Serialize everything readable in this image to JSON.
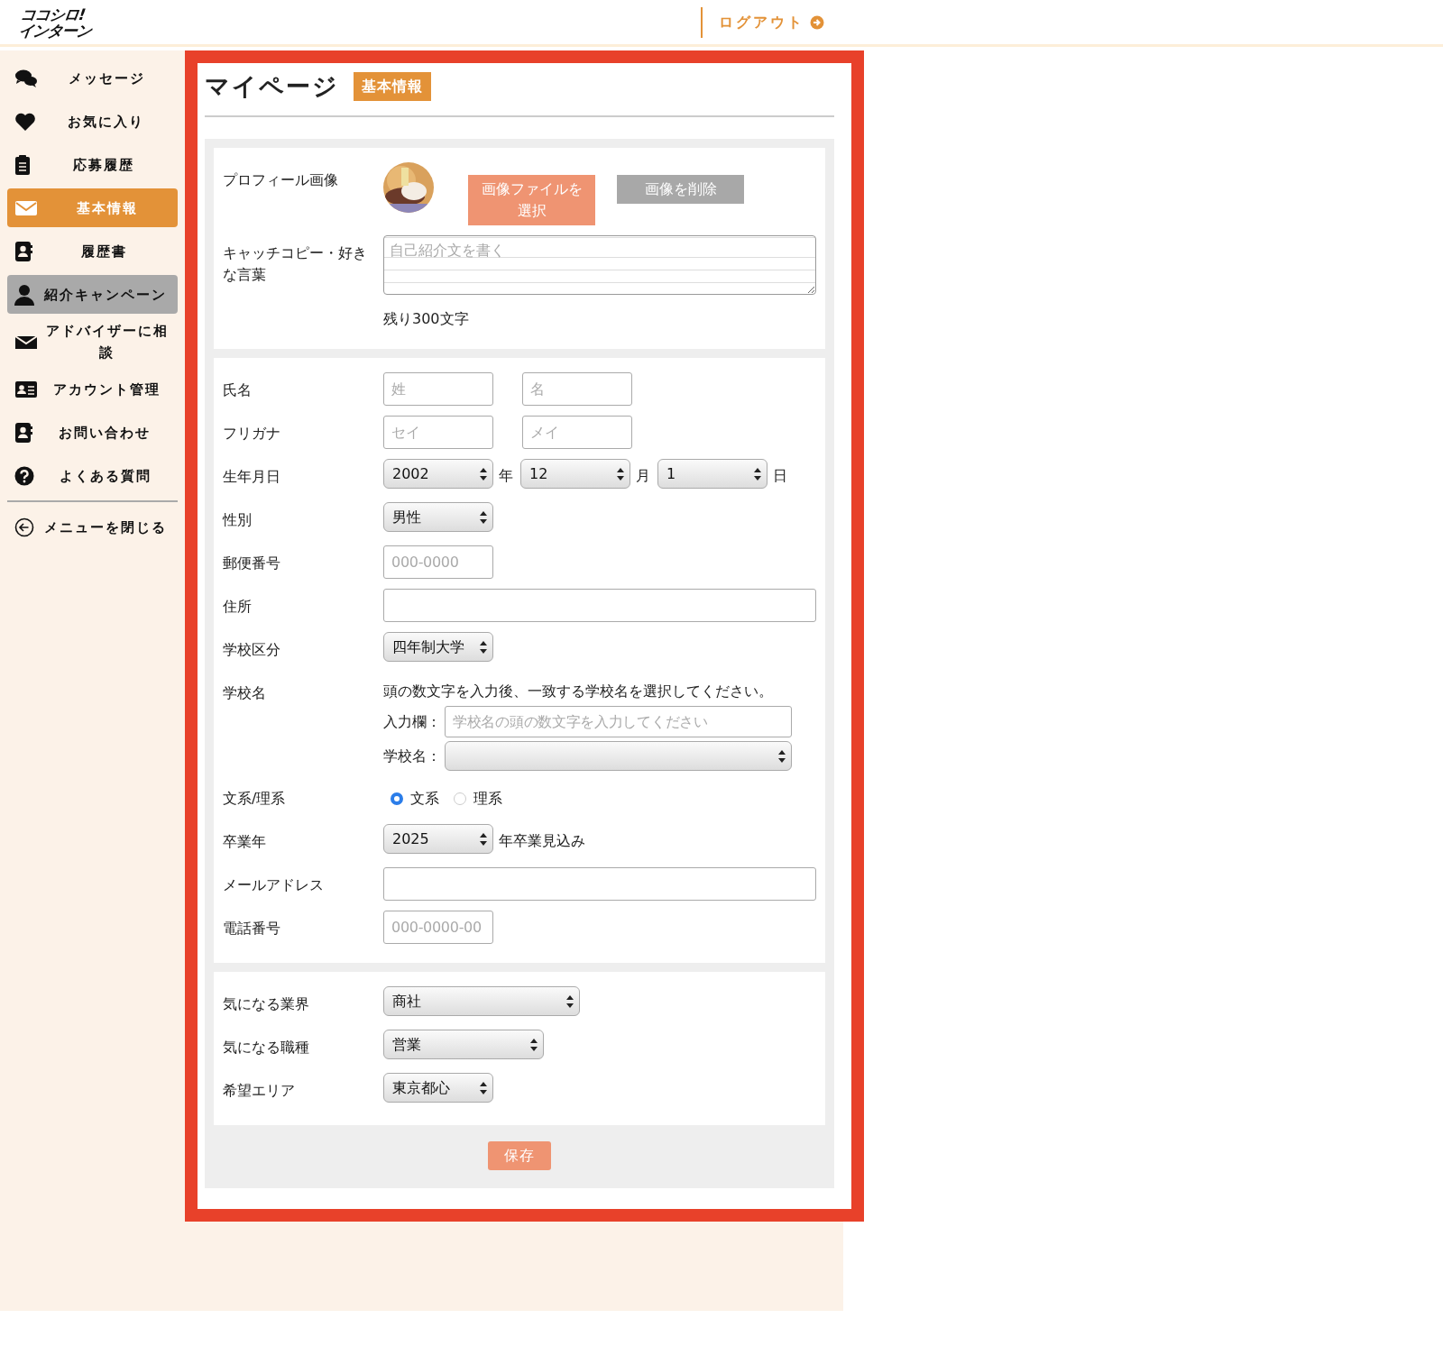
{
  "header": {
    "logo": [
      "ココシロ!",
      "インターン"
    ],
    "logout": "ログアウト"
  },
  "sidebar": {
    "items": [
      {
        "label": "メッセージ",
        "selected": false,
        "highlighted": false
      },
      {
        "label": "お気に入り",
        "selected": false,
        "highlighted": false
      },
      {
        "label": "応募履歴",
        "selected": false,
        "highlighted": false
      },
      {
        "label": "基本情報",
        "selected": true,
        "highlighted": false
      },
      {
        "label": "履歴書",
        "selected": false,
        "highlighted": false
      },
      {
        "label": "紹介キャンペーン",
        "selected": false,
        "highlighted": true
      },
      {
        "label": "アドバイザーに相談",
        "selected": false,
        "highlighted": false
      },
      {
        "label": "アカウント管理",
        "selected": false,
        "highlighted": false
      },
      {
        "label": "お問い合わせ",
        "selected": false,
        "highlighted": false
      },
      {
        "label": "よくある質問",
        "selected": false,
        "highlighted": false
      }
    ],
    "close": "メニューを閉じる"
  },
  "page": {
    "title": "マイページ",
    "badge": "基本情報"
  },
  "sections": [
    {
      "rows": [
        {
          "label": "プロフィール画像",
          "buttons": [
            {
              "label": "画像ファイルを選択"
            },
            {
              "label": "画像を削除"
            }
          ]
        },
        {
          "kind": "textarea",
          "label": "キャッチコピー・好きな言葉",
          "placeholder": "自己紹介文を書く",
          "note": "残り300文字"
        }
      ]
    },
    {
      "rows": [
        {
          "kind": "pair",
          "label": "氏名",
          "fields": [
            {
              "placeholder": "姓"
            },
            {
              "placeholder": "名"
            }
          ]
        },
        {
          "kind": "pair",
          "label": "フリガナ",
          "fields": [
            {
              "placeholder": "セイ"
            },
            {
              "placeholder": "メイ"
            }
          ]
        },
        {
          "kind": "date",
          "label": "生年月日",
          "selects": [
            {
              "value": "2002",
              "suffix": "年"
            },
            {
              "value": "12",
              "suffix": "月"
            },
            {
              "value": "1",
              "suffix": "日"
            }
          ]
        },
        {
          "kind": "select",
          "label": "性別",
          "value": "男性"
        },
        {
          "kind": "short-text",
          "label": "郵便番号",
          "placeholder": "000-0000"
        },
        {
          "kind": "long-text",
          "label": "住所"
        },
        {
          "kind": "select",
          "label": "学校区分",
          "value": "四年制大学"
        },
        {
          "kind": "school",
          "label": "学校名",
          "instruction": "頭の数文字を入力後、一致する学校名を選択してください。",
          "input_label": "入力欄：",
          "placeholder": "学校名の頭の数文字を入力してください",
          "select_label": "学校名："
        },
        {
          "kind": "radio",
          "label": "文系/理系",
          "options": [
            {
              "label": "文系",
              "selected": true
            },
            {
              "label": "理系",
              "selected": false
            }
          ]
        },
        {
          "kind": "select",
          "label": "卒業年",
          "value": "2025",
          "suffix": "年卒業見込み"
        },
        {
          "kind": "long-text",
          "label": "メールアドレス"
        },
        {
          "kind": "short-text",
          "label": "電話番号",
          "placeholder": "000-0000-00"
        }
      ]
    },
    {
      "rows": [
        {
          "kind": "select-wide",
          "label": "気になる業界",
          "value": "商社"
        },
        {
          "kind": "select-medium",
          "label": "気になる職種",
          "value": "営業"
        },
        {
          "kind": "select",
          "label": "希望エリア",
          "value": "東京都心"
        }
      ]
    }
  ],
  "save": "保存"
}
